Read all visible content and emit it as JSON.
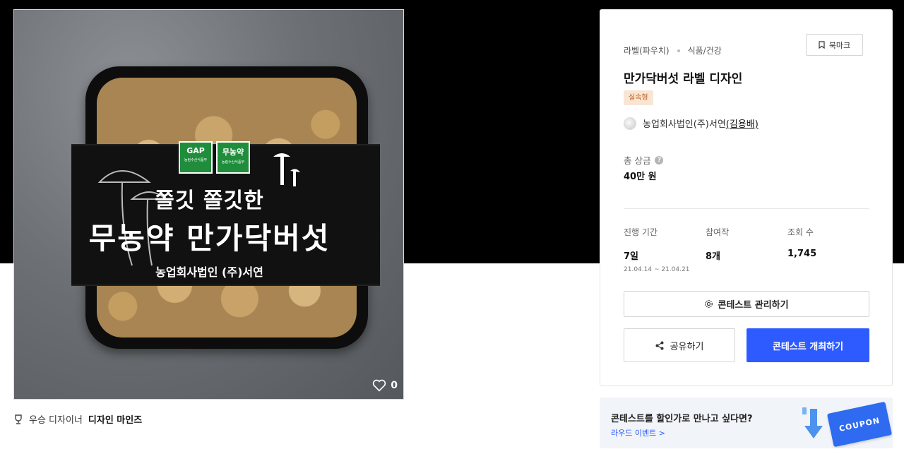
{
  "image": {
    "package_badges": [
      {
        "title": "GAP",
        "sub": "농림수산식품부"
      },
      {
        "title": "무농약",
        "sub": "농림수산식품부"
      }
    ],
    "package_line1": "쫄깃 쫄깃한",
    "package_line2": "무농약 만가닥버섯",
    "package_brand": "농업회사법인 (주)서연",
    "like_count": "0"
  },
  "award": {
    "prefix": "우승 디자이너",
    "designer": "디자인 마인즈"
  },
  "panel": {
    "category": "라벨(파우치)",
    "subcategory": "식품/건강",
    "bookmark_label": "북마크",
    "title": "만가닥버섯 라벨 디자인",
    "tag": "실속형",
    "host_company": "농업회사법인(주)서연",
    "host_user": "(김용배)",
    "prize_label": "총 상금",
    "prize_value": "40만 원",
    "stats": {
      "period_label": "진행 기간",
      "period_value": "7일",
      "period_dates": "21.04.14 ~ 21.04.21",
      "entries_label": "참여작",
      "entries_value": "8개",
      "views_label": "조회 수",
      "views_value": "1,745"
    },
    "manage_label": "콘테스트 관리하기",
    "share_label": "공유하기",
    "host_button_label": "콘테스트 개최하기"
  },
  "promo": {
    "title": "콘테스트를 할인가로 만나고 싶다면?",
    "link": "라우드 이벤트 >",
    "coupon": "COUPON"
  },
  "colors": {
    "accent": "#2e5bff",
    "tag_bg": "#f8e6d4",
    "tag_text": "#c55e1b"
  }
}
